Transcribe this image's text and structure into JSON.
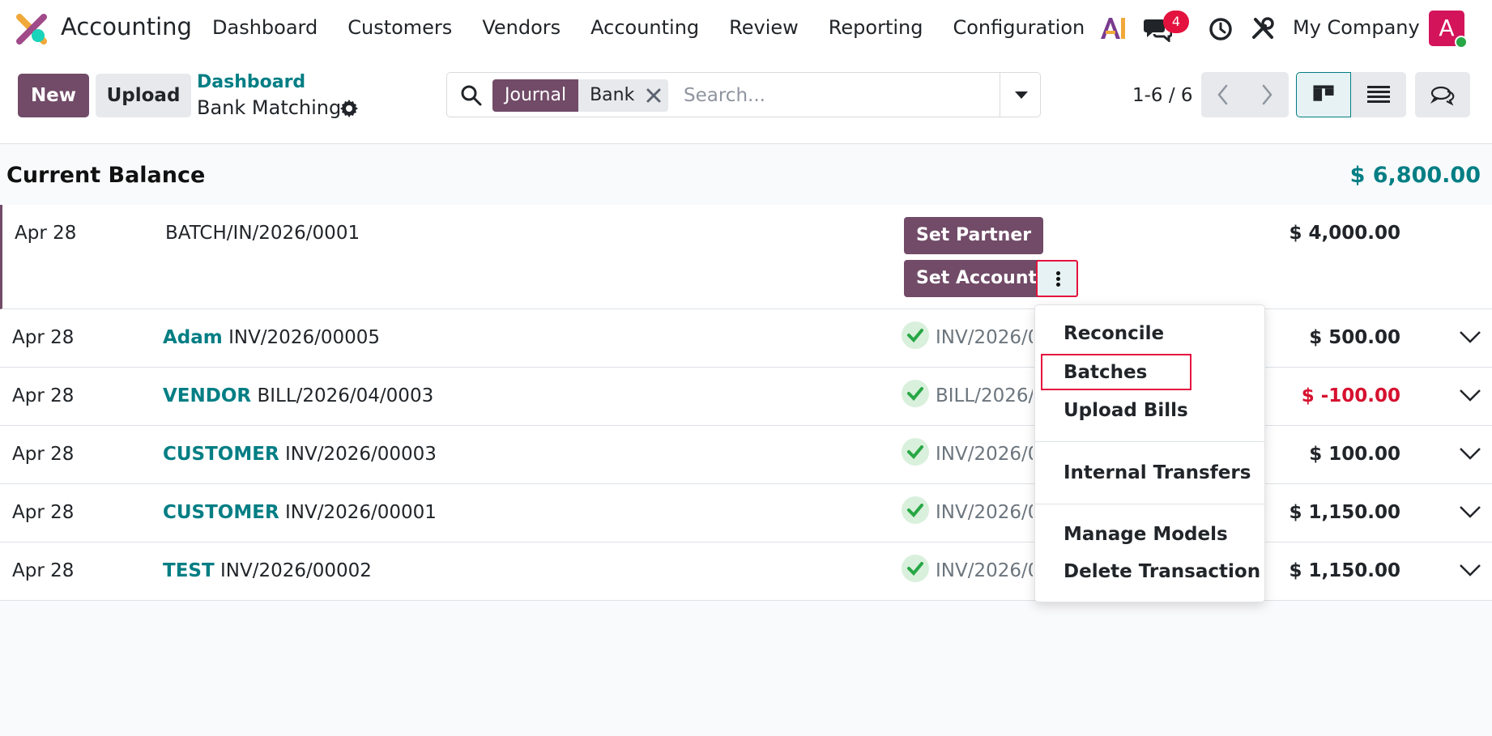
{
  "app": {
    "name": "Accounting",
    "menu": [
      "Dashboard",
      "Customers",
      "Vendors",
      "Accounting",
      "Review",
      "Reporting",
      "Configuration"
    ],
    "notification_count": "4",
    "company": "My Company",
    "avatar_letter": "A"
  },
  "control": {
    "new_label": "New",
    "upload_label": "Upload",
    "breadcrumb_parent": "Dashboard",
    "breadcrumb_current": "Bank Matching",
    "search": {
      "facet_label": "Journal",
      "facet_value": "Bank",
      "placeholder": "Search..."
    },
    "pager": "1-6 / 6"
  },
  "balance": {
    "label": "Current Balance",
    "value": "$ 6,800.00"
  },
  "transactions": [
    {
      "date": "Apr 28",
      "partner": "",
      "label": "BATCH/IN/2026/0001",
      "match": "",
      "amount": "$ 4,000.00",
      "negative": false
    },
    {
      "date": "Apr 28",
      "partner": "Adam",
      "label": "INV/2026/00005",
      "match": "INV/2026/00005",
      "amount": "$ 500.00",
      "negative": false
    },
    {
      "date": "Apr 28",
      "partner": "VENDOR",
      "label": "BILL/2026/04/0003",
      "match": "BILL/2026/04/0003",
      "amount": "$ -100.00",
      "negative": true
    },
    {
      "date": "Apr 28",
      "partner": "CUSTOMER",
      "label": "INV/2026/00003",
      "match": "INV/2026/00003",
      "amount": "$ 100.00",
      "negative": false
    },
    {
      "date": "Apr 28",
      "partner": "CUSTOMER",
      "label": "INV/2026/00001",
      "match": "INV/2026/00001",
      "amount": "$ 1,150.00",
      "negative": false
    },
    {
      "date": "Apr 28",
      "partner": "TEST",
      "label": "INV/2026/00002",
      "match": "INV/2026/00002",
      "amount": "$ 1,150.00",
      "negative": false
    }
  ],
  "row_actions": {
    "set_partner": "Set Partner",
    "set_account": "Set Account"
  },
  "dropdown": {
    "reconcile": "Reconcile",
    "batches": "Batches",
    "upload_bills": "Upload Bills",
    "internal_transfers": "Internal Transfers",
    "manage_models": "Manage Models",
    "delete_transaction": "Delete Transaction"
  },
  "colors": {
    "brand": "#714b67",
    "accent": "#017e84",
    "danger": "#d6112f",
    "highlight_box": "#e4123e"
  }
}
